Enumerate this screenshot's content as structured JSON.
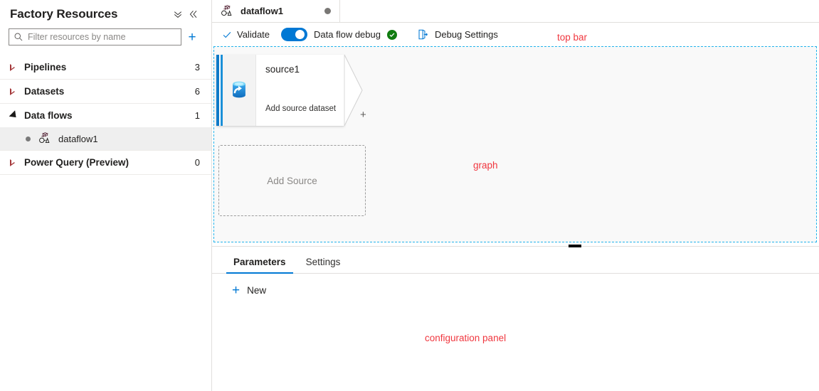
{
  "sidebar": {
    "title": "Factory Resources",
    "collapse_all_icon": "chevron-double-down-icon",
    "collapse_panel_icon": "chevron-double-left-icon",
    "search": {
      "placeholder": "Filter resources by name",
      "value": "",
      "icon": "search-icon"
    },
    "add_label": "+",
    "groups": [
      {
        "label": "Pipelines",
        "count": "3",
        "expanded": false
      },
      {
        "label": "Datasets",
        "count": "6",
        "expanded": false
      },
      {
        "label": "Data flows",
        "count": "1",
        "expanded": true
      },
      {
        "label": "Power Query (Preview)",
        "count": "0",
        "expanded": false
      }
    ],
    "children": [
      {
        "label": "dataflow1",
        "icon": "dataflow-icon",
        "selected": true
      }
    ]
  },
  "tabstrip": {
    "tabs": [
      {
        "label": "dataflow1",
        "icon": "dataflow-icon",
        "dirty_dot": true,
        "active": true
      }
    ]
  },
  "commandbar": {
    "validate_label": "Validate",
    "validate_icon": "checkmark-icon",
    "debug_toggle_label": "Data flow debug",
    "debug_toggle_on": true,
    "debug_status_icon": "status-success-icon",
    "debug_settings_label": "Debug Settings",
    "debug_settings_icon": "debug-settings-icon"
  },
  "graph": {
    "node": {
      "title": "source1",
      "subtitle": "Add source dataset",
      "icon": "source-database-icon",
      "add_transform_label": "+"
    },
    "add_source_label": "Add Source"
  },
  "config": {
    "tabs": [
      {
        "label": "Parameters",
        "active": true
      },
      {
        "label": "Settings",
        "active": false
      }
    ],
    "new_label": "New",
    "new_icon": "plus-icon"
  },
  "annotations": {
    "top_bar": "top bar",
    "graph": "graph",
    "config_panel": "configuration panel"
  },
  "colors": {
    "accent": "#0078d4",
    "annotation": "#f0373f",
    "dashed_region": "#22b3ec",
    "success": "#107c10",
    "tree_arrow": "#a4373a"
  }
}
